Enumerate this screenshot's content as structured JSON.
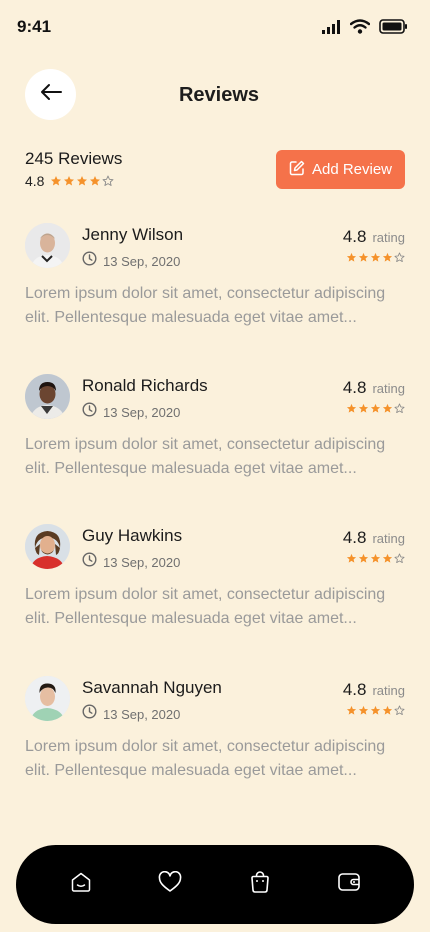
{
  "status_bar": {
    "time": "9:41"
  },
  "header": {
    "title": "Reviews"
  },
  "summary": {
    "count_text": "245 Reviews",
    "rating": "4.8",
    "stars_filled": 4,
    "add_button_label": "Add Review"
  },
  "reviews": [
    {
      "name": "Jenny Wilson",
      "date": "13 Sep, 2020",
      "score": "4.8",
      "score_label": "rating",
      "stars_filled": 4,
      "text": "Lorem ipsum dolor sit amet, consectetur adipiscing elit. Pellentesque malesuada eget vitae amet..."
    },
    {
      "name": "Ronald Richards",
      "date": "13 Sep, 2020",
      "score": "4.8",
      "score_label": "rating",
      "stars_filled": 4,
      "text": "Lorem ipsum dolor sit amet, consectetur adipiscing elit. Pellentesque malesuada eget vitae amet..."
    },
    {
      "name": "Guy Hawkins",
      "date": "13 Sep, 2020",
      "score": "4.8",
      "score_label": "rating",
      "stars_filled": 4,
      "text": "Lorem ipsum dolor sit amet, consectetur adipiscing elit. Pellentesque malesuada eget vitae amet..."
    },
    {
      "name": "Savannah Nguyen",
      "date": "13 Sep, 2020",
      "score": "4.8",
      "score_label": "rating",
      "stars_filled": 4,
      "text": "Lorem ipsum dolor sit amet, consectetur adipiscing elit. Pellentesque malesuada eget vitae amet..."
    }
  ],
  "bottom_nav": {
    "items": [
      {
        "icon": "home-icon"
      },
      {
        "icon": "heart-icon"
      },
      {
        "icon": "bag-icon"
      },
      {
        "icon": "wallet-icon"
      }
    ]
  },
  "colors": {
    "background": "#fbf1dc",
    "accent": "#f5724a",
    "star": "#f5922b",
    "nav_background": "#000000"
  }
}
